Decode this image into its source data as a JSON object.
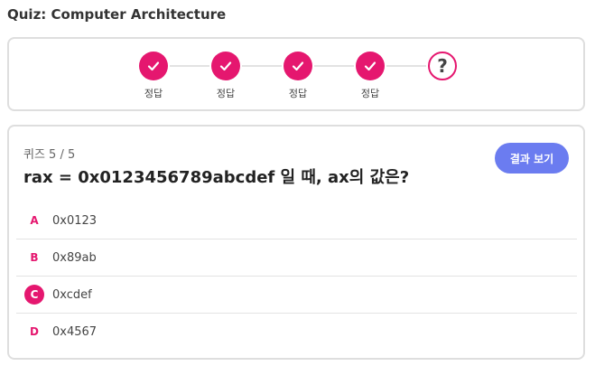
{
  "page": {
    "title": "Quiz: Computer Architecture"
  },
  "progress": {
    "steps": [
      {
        "status": "correct",
        "label": "정답",
        "icon": "check-icon"
      },
      {
        "status": "correct",
        "label": "정답",
        "icon": "check-icon"
      },
      {
        "status": "correct",
        "label": "정답",
        "icon": "check-icon"
      },
      {
        "status": "correct",
        "label": "정답",
        "icon": "check-icon"
      },
      {
        "status": "current",
        "symbol": "?",
        "icon": "question-icon"
      }
    ]
  },
  "quiz": {
    "count": "퀴즈 5 / 5",
    "question": "rax = 0x0123456789abcdef 일 때, ax의 값은?",
    "result_button": "결과 보기",
    "options": [
      {
        "letter": "A",
        "text": "0x0123",
        "selected": false
      },
      {
        "letter": "B",
        "text": "0x89ab",
        "selected": false
      },
      {
        "letter": "C",
        "text": "0xcdef",
        "selected": true
      },
      {
        "letter": "D",
        "text": "0x4567",
        "selected": false
      }
    ]
  },
  "colors": {
    "accent": "#e5176f",
    "button": "#6b7cf0",
    "border": "#dedede"
  }
}
